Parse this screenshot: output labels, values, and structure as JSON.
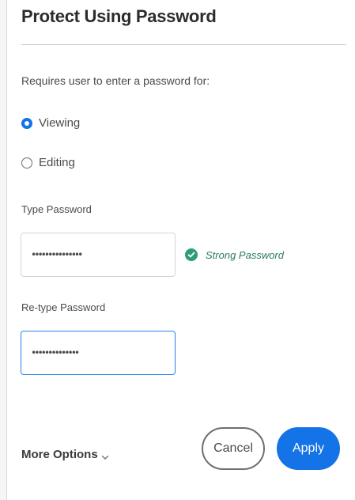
{
  "dialog": {
    "title": "Protect Using Password",
    "subtitle": "Requires user to enter a password for:"
  },
  "mode_options": [
    {
      "label": "Viewing",
      "selected": true
    },
    {
      "label": "Editing",
      "selected": false
    }
  ],
  "password": {
    "label": "Type Password",
    "value": "•••••••••••••••",
    "strength_icon": "check-circle-icon",
    "strength_text": "Strong Password"
  },
  "retype_password": {
    "label": "Re-type Password",
    "value": "••••••••••••••"
  },
  "footer": {
    "more_options_label": "More Options",
    "more_options_icon": "chevron-down-icon",
    "cancel_label": "Cancel",
    "apply_label": "Apply"
  },
  "colors": {
    "accent": "#1473e6",
    "success": "#2d9d78"
  }
}
